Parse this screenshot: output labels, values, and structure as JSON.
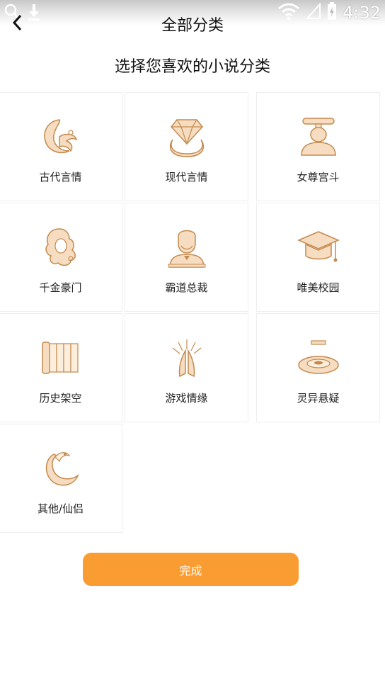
{
  "status_bar": {
    "time": "4:32"
  },
  "header": {
    "title": "全部分类"
  },
  "subtitle": "选择您喜欢的小说分类",
  "categories": [
    {
      "label": "古代言情",
      "icon": "crescent-moon-icon"
    },
    {
      "label": "现代言情",
      "icon": "diamond-ring-icon"
    },
    {
      "label": "女尊宫斗",
      "icon": "empress-icon"
    },
    {
      "label": "千金豪门",
      "icon": "curly-hair-lady-icon"
    },
    {
      "label": "霸道总裁",
      "icon": "ceo-man-icon"
    },
    {
      "label": "唯美校园",
      "icon": "graduation-cap-icon"
    },
    {
      "label": "历史架空",
      "icon": "bamboo-scroll-icon"
    },
    {
      "label": "游戏情缘",
      "icon": "praying-hands-icon"
    },
    {
      "label": "灵异悬疑",
      "icon": "occult-disc-icon"
    },
    {
      "label": "其他/仙侣",
      "icon": "phoenix-moon-icon"
    }
  ],
  "done_button": "完成",
  "colors": {
    "accent": "#f99d32",
    "icon_fill": "#f6dcc0",
    "icon_stroke": "#c48a4e"
  }
}
